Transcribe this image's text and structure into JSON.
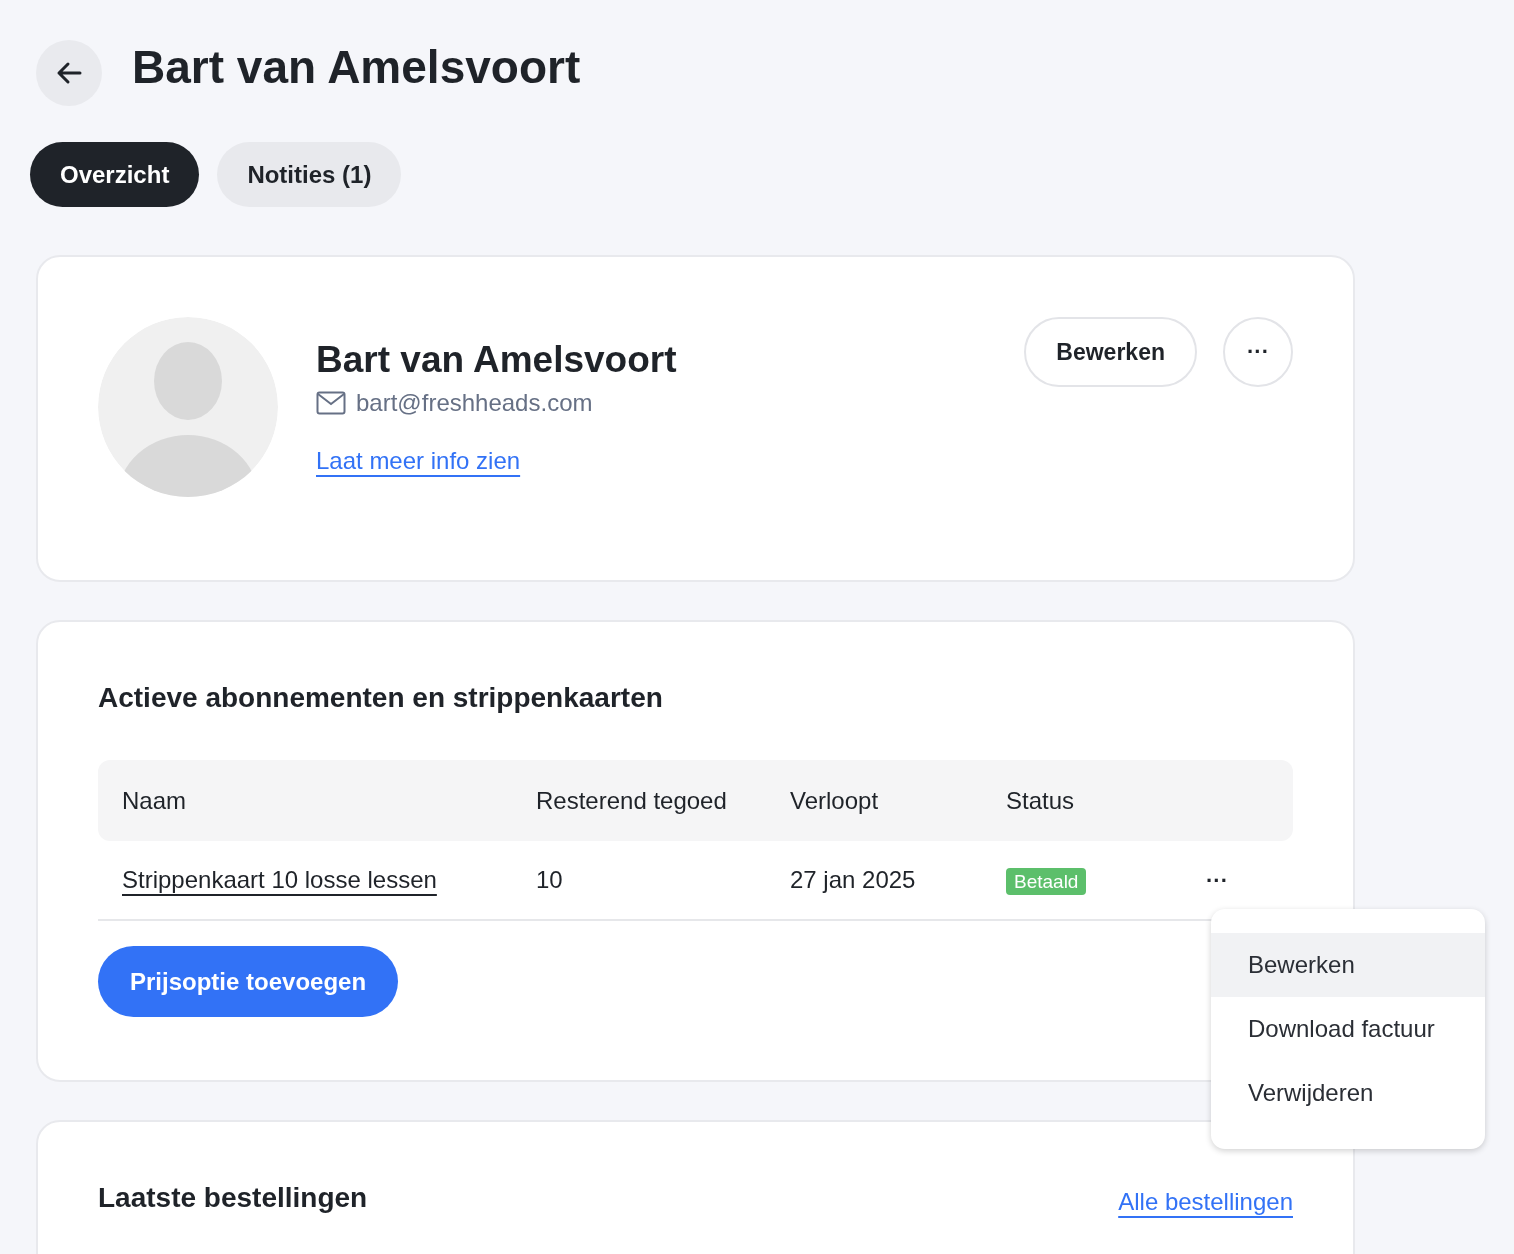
{
  "header": {
    "title": "Bart van Amelsvoort"
  },
  "tabs": [
    {
      "label": "Overzicht",
      "selected": true
    },
    {
      "label": "Notities (1)",
      "selected": false
    }
  ],
  "profile": {
    "name": "Bart van Amelsvoort",
    "email": "bart@freshheads.com",
    "more_link": "Laat meer info zien",
    "edit_button": "Bewerken",
    "more_button": "···"
  },
  "subscriptions": {
    "title": "Actieve abonnementen en strippenkaarten",
    "columns": [
      "Naam",
      "Resterend tegoed",
      "Verloopt",
      "Status"
    ],
    "rows": [
      {
        "name": "Strippenkaart 10 losse lessen",
        "remaining": "10",
        "expires": "27 jan 2025",
        "status": "Betaald",
        "actions": "···"
      }
    ],
    "add_button": "Prijsoptie toevoegen"
  },
  "menu": {
    "items": [
      {
        "label": "Bewerken",
        "selected": true
      },
      {
        "label": "Download factuur",
        "selected": false
      },
      {
        "label": "Verwijderen",
        "selected": false
      }
    ]
  },
  "orders": {
    "title": "Laatste bestellingen",
    "link": "Alle bestellingen"
  }
}
